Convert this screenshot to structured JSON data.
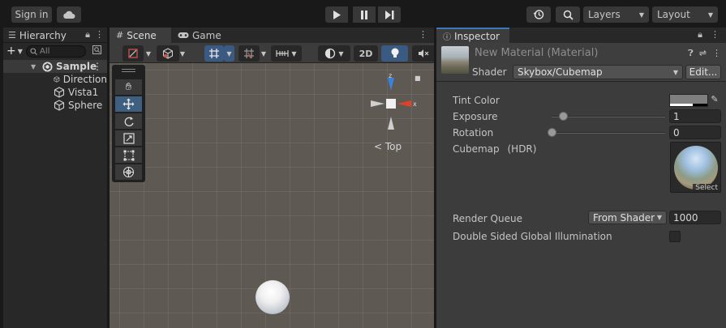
{
  "toolbar": {
    "sign_in": "Sign in",
    "layers": "Layers",
    "layout": "Layout"
  },
  "hierarchy": {
    "tab_label": "Hierarchy",
    "search_placeholder": "All",
    "scene_name": "Sample",
    "objects": [
      "Direction",
      "Vista1",
      "Sphere"
    ]
  },
  "scene": {
    "tabs": [
      "Scene",
      "Game"
    ],
    "mode_2d": "2D",
    "orientation_label": "Top",
    "gizmo_axes": {
      "x": "x",
      "z": "z"
    }
  },
  "inspector": {
    "tab_label": "Inspector",
    "material_name": "New Material (Material)",
    "shader_label": "Shader",
    "shader_value": "Skybox/Cubemap",
    "edit_button": "Edit...",
    "properties": {
      "tint_color": "Tint Color",
      "exposure": "Exposure",
      "exposure_value": "1",
      "exposure_fraction": 0.1,
      "rotation": "Rotation",
      "rotation_value": "0",
      "rotation_fraction": 0.0,
      "cubemap": "Cubemap",
      "cubemap_hdr": "(HDR)",
      "cubemap_select": "Select",
      "render_queue": "Render Queue",
      "render_queue_mode": "From Shader",
      "render_queue_value": "1000",
      "double_sided_gi": "Double Sided Global Illumination"
    }
  },
  "colors": {
    "accent_blue": "#3a79bb",
    "active_tool": "#3e5f80",
    "gizmo_x": "#e0412f",
    "gizmo_z": "#3a82e0",
    "tint": "#7f7f7f"
  }
}
